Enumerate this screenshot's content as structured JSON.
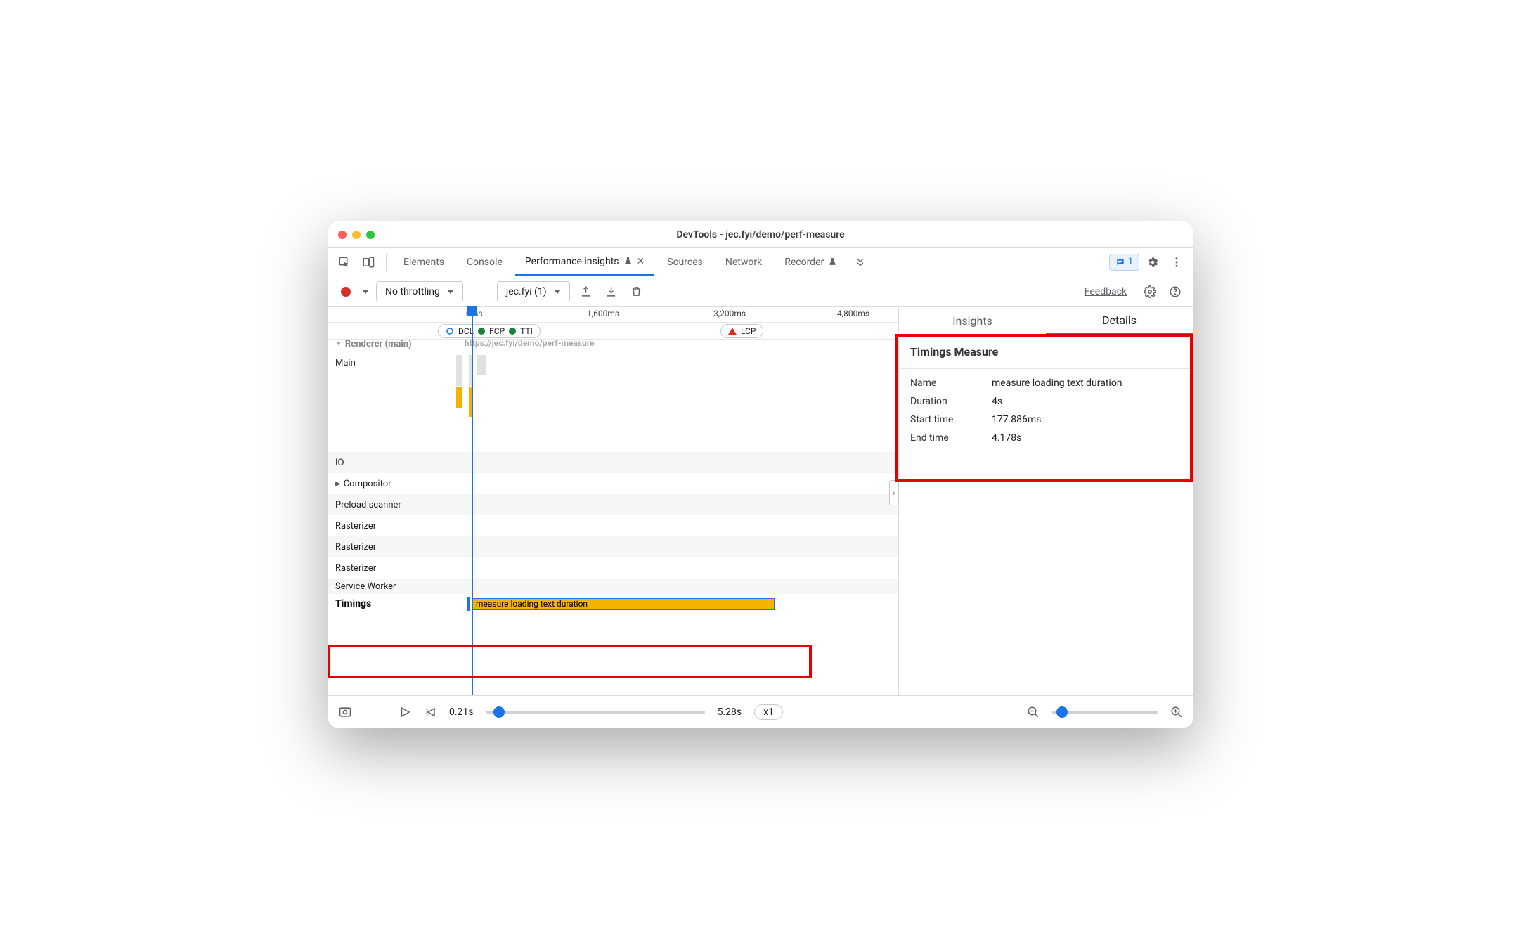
{
  "window": {
    "title": "DevTools - jec.fyi/demo/perf-measure"
  },
  "tabs": {
    "items": [
      "Elements",
      "Console",
      "Performance insights",
      "Sources",
      "Network",
      "Recorder"
    ],
    "active": "Performance insights",
    "issues_count": "1"
  },
  "toolbar": {
    "throttling": "No throttling",
    "recording_select": "jec.fyi (1)",
    "feedback": "Feedback"
  },
  "ruler": {
    "ticks": [
      "0ms",
      "1,600ms",
      "3,200ms",
      "4,800ms"
    ]
  },
  "markers": {
    "group1": [
      "DCL",
      "FCP",
      "TTI"
    ],
    "lcp": "LCP"
  },
  "tracks": {
    "renderer_header": "Renderer (main)",
    "url": "https://jec.fyi/demo/perf-measure",
    "rows": [
      "Main",
      "IO",
      "Compositor",
      "Preload scanner",
      "Rasterizer",
      "Rasterizer",
      "Rasterizer",
      "Service Worker"
    ],
    "timings_label": "Timings",
    "measure_label": "measure loading text duration"
  },
  "sidebar": {
    "tabs": {
      "insights": "Insights",
      "details": "Details"
    },
    "panel_title": "Timings Measure",
    "kv": {
      "name_k": "Name",
      "name_v": "measure loading text duration",
      "duration_k": "Duration",
      "duration_v": "4s",
      "start_k": "Start time",
      "start_v": "177.886ms",
      "end_k": "End time",
      "end_v": "4.178s"
    }
  },
  "bottom": {
    "start": "0.21s",
    "end": "5.28s",
    "speed": "x1"
  }
}
